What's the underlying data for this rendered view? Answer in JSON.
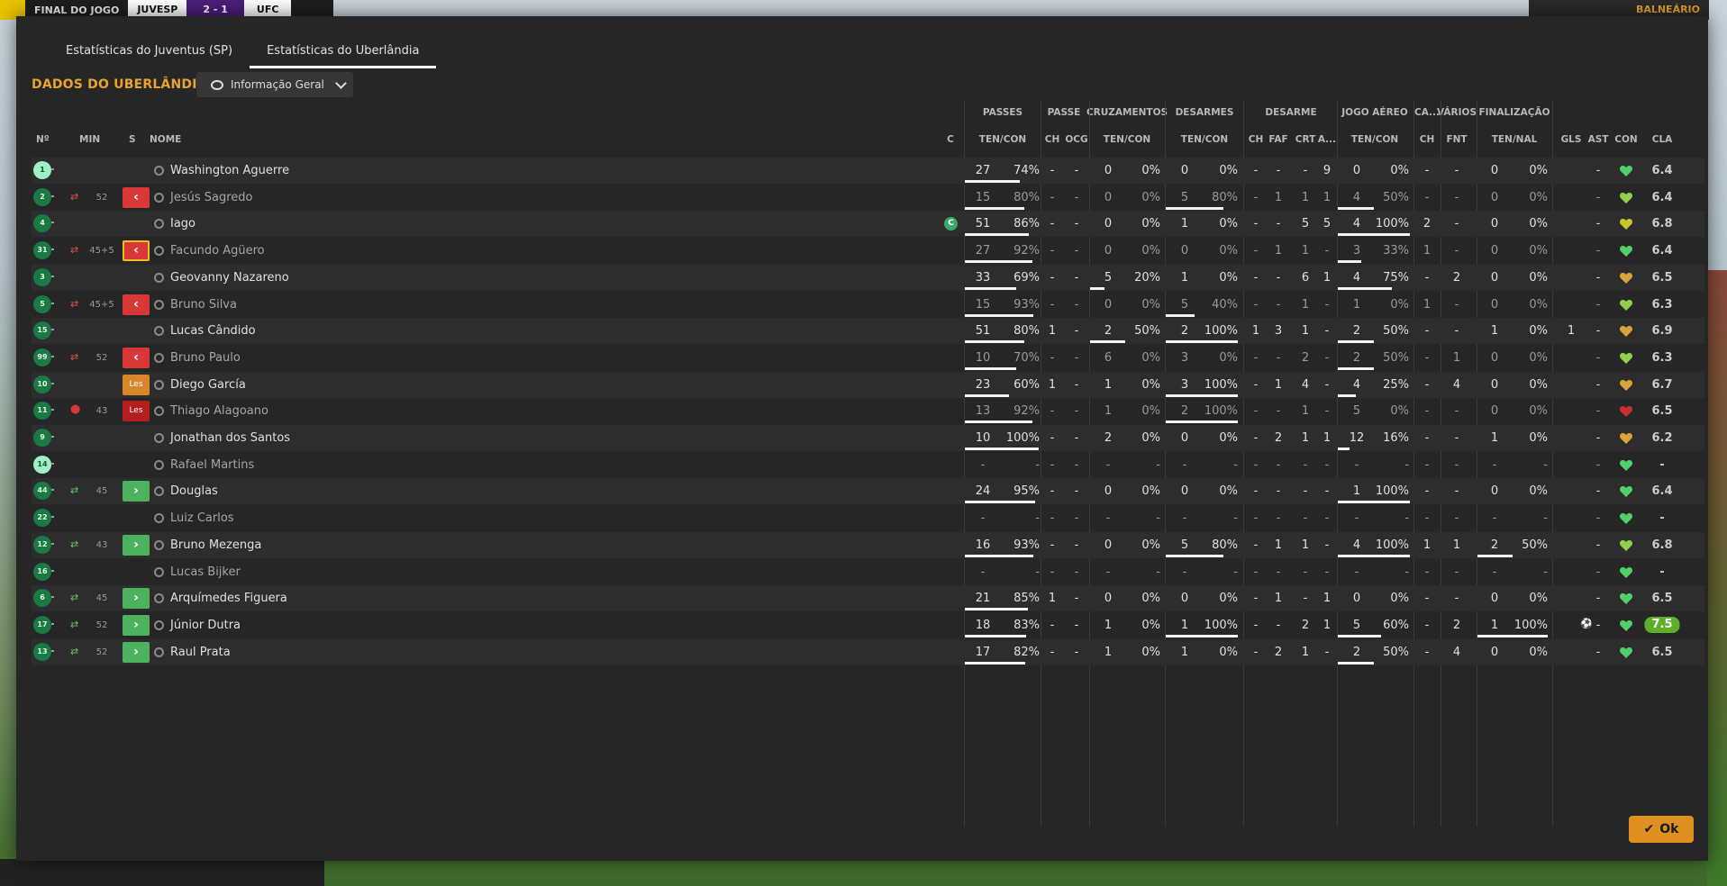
{
  "background": {
    "scoreboard": {
      "status": "FINAL DO JOGO",
      "home": "JUVESP",
      "score": "2 - 1",
      "away": "UFC"
    },
    "top_right_label": "BALNEÁRIO"
  },
  "dialog": {
    "tabs": [
      {
        "label": "Estatísticas do Juventus (SP)",
        "active": false
      },
      {
        "label": "Estatísticas do Uberlândia",
        "active": true
      }
    ],
    "title": "DADOS DO UBERLÂNDIA",
    "view_selector": "Informação Geral",
    "ok_label": "Ok"
  },
  "table": {
    "group_headers": [
      "PASSES",
      "PASSE",
      "CRUZAMENTOS",
      "DESARMES",
      "DESARME",
      "JOGO AÉREO",
      "CA...",
      "VÁRIOS",
      "FINALIZAÇÃO"
    ],
    "column_headers": [
      "Nº",
      "MIN",
      "S",
      "NOME",
      "C",
      "TEN/CON",
      "CH",
      "OCG",
      "TEN/CON",
      "TEN/CON",
      "CH",
      "FAF",
      "CRT",
      "A...",
      "TEN/CON",
      "CH",
      "FNT",
      "TEN/NAL",
      "GLS",
      "AST",
      "CON",
      "CLA"
    ],
    "rows": [
      {
        "no": "1",
        "gk": true,
        "sub": "",
        "min": "",
        "badge": "",
        "name": "Washington Aguerre",
        "played": true,
        "cap": false,
        "p_t": "27",
        "p_pct": "74%",
        "p_bar": 0.74,
        "ch": "-",
        "ocg": "-",
        "cz_t": "0",
        "cz_pct": "0%",
        "cz_bar": 0,
        "ds_t": "0",
        "ds_pct": "0%",
        "ds_bar": 0,
        "d_ch": "-",
        "d_faf": "-",
        "d_crt": "-",
        "d_a": "9",
        "ja_t": "0",
        "ja_pct": "0%",
        "ja_bar": 0,
        "ca_ch": "-",
        "fnt": "-",
        "f_t": "0",
        "f_pct": "0%",
        "f_bar": 0,
        "gls": "",
        "ast": "-",
        "con": "green",
        "cla": "6.4",
        "best": false,
        "assist_icon": false
      },
      {
        "no": "2",
        "gk": false,
        "sub": "out",
        "min": "52",
        "badge": "out",
        "name": "Jesús Sagredo",
        "played": false,
        "cap": false,
        "p_t": "15",
        "p_pct": "80%",
        "p_bar": 0.8,
        "ch": "-",
        "ocg": "-",
        "cz_t": "0",
        "cz_pct": "0%",
        "cz_bar": 0,
        "ds_t": "5",
        "ds_pct": "80%",
        "ds_bar": 0.8,
        "d_ch": "-",
        "d_faf": "1",
        "d_crt": "1",
        "d_a": "1",
        "ja_t": "4",
        "ja_pct": "50%",
        "ja_bar": 0.5,
        "ca_ch": "-",
        "fnt": "-",
        "f_t": "0",
        "f_pct": "0%",
        "f_bar": 0,
        "gls": "",
        "ast": "-",
        "con": "greenyellow",
        "cla": "6.4",
        "best": false,
        "assist_icon": false
      },
      {
        "no": "4",
        "gk": false,
        "sub": "",
        "min": "",
        "badge": "",
        "name": "Iago",
        "played": true,
        "cap": true,
        "p_t": "51",
        "p_pct": "86%",
        "p_bar": 0.86,
        "ch": "-",
        "ocg": "-",
        "cz_t": "0",
        "cz_pct": "0%",
        "cz_bar": 0,
        "ds_t": "1",
        "ds_pct": "0%",
        "ds_bar": 0,
        "d_ch": "-",
        "d_faf": "-",
        "d_crt": "5",
        "d_a": "5",
        "ja_t": "4",
        "ja_pct": "100%",
        "ja_bar": 1,
        "ca_ch": "2",
        "fnt": "-",
        "f_t": "0",
        "f_pct": "0%",
        "f_bar": 0,
        "gls": "",
        "ast": "-",
        "con": "yellow",
        "cla": "6.8",
        "best": false,
        "assist_icon": false
      },
      {
        "no": "31",
        "gk": false,
        "sub": "out",
        "min": "45+5",
        "badge": "outy",
        "name": "Facundo Agüero",
        "played": false,
        "cap": false,
        "p_t": "27",
        "p_pct": "92%",
        "p_bar": 0.92,
        "ch": "-",
        "ocg": "-",
        "cz_t": "0",
        "cz_pct": "0%",
        "cz_bar": 0,
        "ds_t": "0",
        "ds_pct": "0%",
        "ds_bar": 0,
        "d_ch": "-",
        "d_faf": "1",
        "d_crt": "1",
        "d_a": "-",
        "ja_t": "3",
        "ja_pct": "33%",
        "ja_bar": 0.33,
        "ca_ch": "1",
        "fnt": "-",
        "f_t": "0",
        "f_pct": "0%",
        "f_bar": 0,
        "gls": "",
        "ast": "-",
        "con": "green",
        "cla": "6.4",
        "best": false,
        "assist_icon": false
      },
      {
        "no": "3",
        "gk": false,
        "sub": "",
        "min": "",
        "badge": "",
        "name": "Geovanny Nazareno",
        "played": true,
        "cap": false,
        "p_t": "33",
        "p_pct": "69%",
        "p_bar": 0.69,
        "ch": "-",
        "ocg": "-",
        "cz_t": "5",
        "cz_pct": "20%",
        "cz_bar": 0.2,
        "ds_t": "1",
        "ds_pct": "0%",
        "ds_bar": 0,
        "d_ch": "-",
        "d_faf": "-",
        "d_crt": "6",
        "d_a": "1",
        "ja_t": "4",
        "ja_pct": "75%",
        "ja_bar": 0.75,
        "ca_ch": "-",
        "fnt": "2",
        "f_t": "0",
        "f_pct": "0%",
        "f_bar": 0,
        "gls": "",
        "ast": "-",
        "con": "orange",
        "cla": "6.5",
        "best": false,
        "assist_icon": false
      },
      {
        "no": "5",
        "gk": false,
        "sub": "out",
        "min": "45+5",
        "badge": "out",
        "name": "Bruno Silva",
        "played": false,
        "cap": false,
        "p_t": "15",
        "p_pct": "93%",
        "p_bar": 0.93,
        "ch": "-",
        "ocg": "-",
        "cz_t": "0",
        "cz_pct": "0%",
        "cz_bar": 0,
        "ds_t": "5",
        "ds_pct": "40%",
        "ds_bar": 0.4,
        "d_ch": "-",
        "d_faf": "-",
        "d_crt": "1",
        "d_a": "-",
        "ja_t": "1",
        "ja_pct": "0%",
        "ja_bar": 0,
        "ca_ch": "1",
        "fnt": "-",
        "f_t": "0",
        "f_pct": "0%",
        "f_bar": 0,
        "gls": "",
        "ast": "-",
        "con": "greenyellow",
        "cla": "6.3",
        "best": false,
        "assist_icon": false
      },
      {
        "no": "15",
        "gk": false,
        "sub": "",
        "min": "",
        "badge": "",
        "name": "Lucas Cândido",
        "played": true,
        "cap": false,
        "p_t": "51",
        "p_pct": "80%",
        "p_bar": 0.8,
        "ch": "1",
        "ocg": "-",
        "cz_t": "2",
        "cz_pct": "50%",
        "cz_bar": 0.5,
        "ds_t": "2",
        "ds_pct": "100%",
        "ds_bar": 1,
        "d_ch": "1",
        "d_faf": "3",
        "d_crt": "1",
        "d_a": "-",
        "ja_t": "2",
        "ja_pct": "50%",
        "ja_bar": 0.5,
        "ca_ch": "-",
        "fnt": "-",
        "f_t": "1",
        "f_pct": "0%",
        "f_bar": 0,
        "gls": "1",
        "ast": "-",
        "con": "orange",
        "cla": "6.9",
        "best": false,
        "assist_icon": false
      },
      {
        "no": "99",
        "gk": false,
        "sub": "out",
        "min": "52",
        "badge": "out",
        "name": "Bruno Paulo",
        "played": false,
        "cap": false,
        "p_t": "10",
        "p_pct": "70%",
        "p_bar": 0.7,
        "ch": "-",
        "ocg": "-",
        "cz_t": "6",
        "cz_pct": "0%",
        "cz_bar": 0,
        "ds_t": "3",
        "ds_pct": "0%",
        "ds_bar": 0,
        "d_ch": "-",
        "d_faf": "-",
        "d_crt": "2",
        "d_a": "-",
        "ja_t": "2",
        "ja_pct": "50%",
        "ja_bar": 0.5,
        "ca_ch": "-",
        "fnt": "1",
        "f_t": "0",
        "f_pct": "0%",
        "f_bar": 0,
        "gls": "",
        "ast": "-",
        "con": "greenyellow",
        "cla": "6.3",
        "best": false,
        "assist_icon": false
      },
      {
        "no": "10",
        "gk": false,
        "sub": "",
        "min": "",
        "badge": "les",
        "name": "Diego García",
        "played": true,
        "cap": false,
        "p_t": "23",
        "p_pct": "60%",
        "p_bar": 0.6,
        "ch": "1",
        "ocg": "-",
        "cz_t": "1",
        "cz_pct": "0%",
        "cz_bar": 0,
        "ds_t": "3",
        "ds_pct": "100%",
        "ds_bar": 1,
        "d_ch": "-",
        "d_faf": "1",
        "d_crt": "4",
        "d_a": "-",
        "ja_t": "4",
        "ja_pct": "25%",
        "ja_bar": 0.25,
        "ca_ch": "-",
        "fnt": "4",
        "f_t": "0",
        "f_pct": "0%",
        "f_bar": 0,
        "gls": "",
        "ast": "-",
        "con": "orange",
        "cla": "6.7",
        "best": false,
        "assist_icon": false
      },
      {
        "no": "11",
        "gk": false,
        "sub": "injury",
        "min": "43",
        "badge": "lesr",
        "name": "Thiago Alagoano",
        "played": false,
        "cap": false,
        "p_t": "13",
        "p_pct": "92%",
        "p_bar": 0.92,
        "ch": "-",
        "ocg": "-",
        "cz_t": "1",
        "cz_pct": "0%",
        "cz_bar": 0,
        "ds_t": "2",
        "ds_pct": "100%",
        "ds_bar": 1,
        "d_ch": "-",
        "d_faf": "-",
        "d_crt": "1",
        "d_a": "-",
        "ja_t": "5",
        "ja_pct": "0%",
        "ja_bar": 0,
        "ca_ch": "-",
        "fnt": "-",
        "f_t": "0",
        "f_pct": "0%",
        "f_bar": 0,
        "gls": "",
        "ast": "-",
        "con": "red",
        "cla": "6.5",
        "best": false,
        "assist_icon": false
      },
      {
        "no": "9",
        "gk": false,
        "sub": "",
        "min": "",
        "badge": "",
        "name": "Jonathan dos Santos",
        "played": true,
        "cap": false,
        "p_t": "10",
        "p_pct": "100%",
        "p_bar": 1,
        "ch": "-",
        "ocg": "-",
        "cz_t": "2",
        "cz_pct": "0%",
        "cz_bar": 0,
        "ds_t": "0",
        "ds_pct": "0%",
        "ds_bar": 0,
        "d_ch": "-",
        "d_faf": "2",
        "d_crt": "1",
        "d_a": "1",
        "ja_t": "12",
        "ja_pct": "16%",
        "ja_bar": 0.16,
        "ca_ch": "-",
        "fnt": "-",
        "f_t": "1",
        "f_pct": "0%",
        "f_bar": 0,
        "gls": "",
        "ast": "-",
        "con": "orange",
        "cla": "6.2",
        "best": false,
        "assist_icon": false
      },
      {
        "no": "14",
        "gk": true,
        "sub": "",
        "min": "",
        "badge": "",
        "name": "Rafael Martins",
        "played": false,
        "cap": false,
        "empty": true,
        "p_t": "-",
        "p_pct": "-",
        "p_bar": 0,
        "ch": "-",
        "ocg": "-",
        "cz_t": "-",
        "cz_pct": "-",
        "cz_bar": 0,
        "ds_t": "-",
        "ds_pct": "-",
        "ds_bar": 0,
        "d_ch": "-",
        "d_faf": "-",
        "d_crt": "-",
        "d_a": "-",
        "ja_t": "-",
        "ja_pct": "-",
        "ja_bar": 0,
        "ca_ch": "-",
        "fnt": "-",
        "f_t": "-",
        "f_pct": "-",
        "f_bar": 0,
        "gls": "",
        "ast": "-",
        "con": "green",
        "cla": "-",
        "best": false,
        "assist_icon": false
      },
      {
        "no": "44",
        "gk": false,
        "sub": "in",
        "min": "45",
        "badge": "in",
        "name": "Douglas",
        "played": true,
        "cap": false,
        "p_t": "24",
        "p_pct": "95%",
        "p_bar": 0.95,
        "ch": "-",
        "ocg": "-",
        "cz_t": "0",
        "cz_pct": "0%",
        "cz_bar": 0,
        "ds_t": "0",
        "ds_pct": "0%",
        "ds_bar": 0,
        "d_ch": "-",
        "d_faf": "-",
        "d_crt": "-",
        "d_a": "-",
        "ja_t": "1",
        "ja_pct": "100%",
        "ja_bar": 1,
        "ca_ch": "-",
        "fnt": "-",
        "f_t": "0",
        "f_pct": "0%",
        "f_bar": 0,
        "gls": "",
        "ast": "-",
        "con": "green",
        "cla": "6.4",
        "best": false,
        "assist_icon": false
      },
      {
        "no": "22",
        "gk": false,
        "sub": "",
        "min": "",
        "badge": "",
        "name": "Luiz Carlos",
        "played": false,
        "cap": false,
        "empty": true,
        "p_t": "-",
        "p_pct": "-",
        "p_bar": 0,
        "ch": "-",
        "ocg": "-",
        "cz_t": "-",
        "cz_pct": "-",
        "cz_bar": 0,
        "ds_t": "-",
        "ds_pct": "-",
        "ds_bar": 0,
        "d_ch": "-",
        "d_faf": "-",
        "d_crt": "-",
        "d_a": "-",
        "ja_t": "-",
        "ja_pct": "-",
        "ja_bar": 0,
        "ca_ch": "-",
        "fnt": "-",
        "f_t": "-",
        "f_pct": "-",
        "f_bar": 0,
        "gls": "",
        "ast": "-",
        "con": "green",
        "cla": "-",
        "best": false,
        "assist_icon": false
      },
      {
        "no": "12",
        "gk": false,
        "sub": "in",
        "min": "43",
        "badge": "in",
        "name": "Bruno Mezenga",
        "played": true,
        "cap": false,
        "p_t": "16",
        "p_pct": "93%",
        "p_bar": 0.93,
        "ch": "-",
        "ocg": "-",
        "cz_t": "0",
        "cz_pct": "0%",
        "cz_bar": 0,
        "ds_t": "5",
        "ds_pct": "80%",
        "ds_bar": 0.8,
        "d_ch": "-",
        "d_faf": "1",
        "d_crt": "1",
        "d_a": "-",
        "ja_t": "4",
        "ja_pct": "100%",
        "ja_bar": 1,
        "ca_ch": "1",
        "fnt": "1",
        "f_t": "2",
        "f_pct": "50%",
        "f_bar": 0.5,
        "gls": "",
        "ast": "-",
        "con": "greenyellow",
        "cla": "6.8",
        "best": false,
        "assist_icon": false
      },
      {
        "no": "16",
        "gk": false,
        "sub": "",
        "min": "",
        "badge": "",
        "name": "Lucas Bijker",
        "played": false,
        "cap": false,
        "empty": true,
        "p_t": "-",
        "p_pct": "-",
        "p_bar": 0,
        "ch": "-",
        "ocg": "-",
        "cz_t": "-",
        "cz_pct": "-",
        "cz_bar": 0,
        "ds_t": "-",
        "ds_pct": "-",
        "ds_bar": 0,
        "d_ch": "-",
        "d_faf": "-",
        "d_crt": "-",
        "d_a": "-",
        "ja_t": "-",
        "ja_pct": "-",
        "ja_bar": 0,
        "ca_ch": "-",
        "fnt": "-",
        "f_t": "-",
        "f_pct": "-",
        "f_bar": 0,
        "gls": "",
        "ast": "-",
        "con": "green",
        "cla": "-",
        "best": false,
        "assist_icon": false
      },
      {
        "no": "6",
        "gk": false,
        "sub": "in",
        "min": "45",
        "badge": "in",
        "name": "Arquímedes Figuera",
        "played": true,
        "cap": false,
        "p_t": "21",
        "p_pct": "85%",
        "p_bar": 0.85,
        "ch": "1",
        "ocg": "-",
        "cz_t": "0",
        "cz_pct": "0%",
        "cz_bar": 0,
        "ds_t": "0",
        "ds_pct": "0%",
        "ds_bar": 0,
        "d_ch": "-",
        "d_faf": "1",
        "d_crt": "-",
        "d_a": "1",
        "ja_t": "0",
        "ja_pct": "0%",
        "ja_bar": 0,
        "ca_ch": "-",
        "fnt": "-",
        "f_t": "0",
        "f_pct": "0%",
        "f_bar": 0,
        "gls": "",
        "ast": "-",
        "con": "green",
        "cla": "6.5",
        "best": false,
        "assist_icon": false
      },
      {
        "no": "17",
        "gk": false,
        "sub": "in",
        "min": "52",
        "badge": "in",
        "name": "Júnior Dutra",
        "played": true,
        "cap": false,
        "p_t": "18",
        "p_pct": "83%",
        "p_bar": 0.83,
        "ch": "-",
        "ocg": "-",
        "cz_t": "1",
        "cz_pct": "0%",
        "cz_bar": 0,
        "ds_t": "1",
        "ds_pct": "100%",
        "ds_bar": 1,
        "d_ch": "-",
        "d_faf": "-",
        "d_crt": "2",
        "d_a": "1",
        "ja_t": "5",
        "ja_pct": "60%",
        "ja_bar": 0.6,
        "ca_ch": "-",
        "fnt": "2",
        "f_t": "1",
        "f_pct": "100%",
        "f_bar": 1,
        "gls": "",
        "ast": "-",
        "con": "green",
        "cla": "7.5",
        "best": true,
        "assist_icon": true
      },
      {
        "no": "13",
        "gk": false,
        "sub": "in",
        "min": "52",
        "badge": "in",
        "name": "Raul Prata",
        "played": true,
        "cap": false,
        "p_t": "17",
        "p_pct": "82%",
        "p_bar": 0.82,
        "ch": "-",
        "ocg": "-",
        "cz_t": "1",
        "cz_pct": "0%",
        "cz_bar": 0,
        "ds_t": "1",
        "ds_pct": "0%",
        "ds_bar": 0,
        "d_ch": "-",
        "d_faf": "2",
        "d_crt": "1",
        "d_a": "-",
        "ja_t": "2",
        "ja_pct": "50%",
        "ja_bar": 0.5,
        "ca_ch": "-",
        "fnt": "4",
        "f_t": "0",
        "f_pct": "0%",
        "f_bar": 0,
        "gls": "",
        "ast": "-",
        "con": "green",
        "cla": "6.5",
        "best": false,
        "assist_icon": false
      }
    ]
  },
  "colors": {
    "accent": "#e8a330",
    "sub_out": "#d93838",
    "sub_in": "#4cb25f",
    "best_rating": "#5fae2a"
  }
}
